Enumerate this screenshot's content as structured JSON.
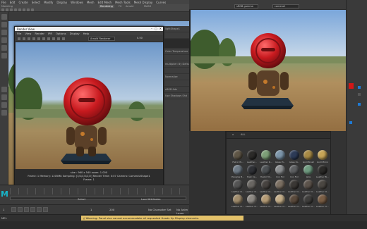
{
  "main_window": {
    "menu": [
      "File",
      "Edit",
      "Create",
      "Select",
      "Modify",
      "Display",
      "Windows",
      "Mesh",
      "Edit Mesh",
      "Mesh Tools",
      "Mesh Display",
      "Curves",
      "Surfaces",
      "Deform",
      "UV",
      "Generate",
      "Cache",
      "Arnold",
      "Help"
    ],
    "mode": "Modeling",
    "shelf_tabs": [
      "Rendering",
      "FX",
      "FX Caching",
      "Custom",
      "Arnold",
      "Bifrost",
      "MASH",
      "Motion Graphics",
      "XGen",
      "Substance"
    ]
  },
  "render_view": {
    "title": "Render View",
    "menu": [
      "File",
      "View",
      "Render",
      "IPR",
      "Options",
      "Display",
      "Help"
    ],
    "renderer": "Arnold Renderer",
    "zoom": "0.50",
    "info_line1": "size : 960 x 540  zoom: 1.000",
    "info_line2": "Frame: 1    Memory: 1205Mb    Sampling: [3/2/2/2/2/2]    Render Time: 0:07    Camera: CameraUShape1",
    "info_line3": "Frame: 1"
  },
  "right_viewport": {
    "dropdown_a": "sRGB gamma",
    "dropdown_b": "camera1"
  },
  "material_library": {
    "toolbar_label": "ALL",
    "materials": [
      {
        "name": "Fabric W...",
        "color": "#5f5646"
      },
      {
        "name": "Leather...",
        "color": "#2c2b29"
      },
      {
        "name": "Leather R...",
        "color": "#7d9f77"
      },
      {
        "name": "Glass Pl...",
        "color": "#7c95a9"
      },
      {
        "name": "Glass Ri...",
        "color": "#2d3b57"
      },
      {
        "name": "Gold Brush",
        "color": "#a88a45"
      },
      {
        "name": "Gold Mirror",
        "color": "#c7a557"
      },
      {
        "name": "Plexglas B...",
        "color": "#6e7a86"
      },
      {
        "name": "Plast Ca...",
        "color": "#2f3136"
      },
      {
        "name": "Plastic Mi...",
        "color": "#4d5154"
      },
      {
        "name": "Iron Foil",
        "color": "#8b8e90"
      },
      {
        "name": "Iron Foil",
        "color": "#5e6062"
      },
      {
        "name": "Jade",
        "color": "#6f9b80"
      },
      {
        "name": "Leather Bl...",
        "color": "#2b2a28"
      },
      {
        "name": "Leather Cl...",
        "color": "#545454"
      },
      {
        "name": "Leather Cl...",
        "color": "#6a6763"
      },
      {
        "name": "Leather Cl...",
        "color": "#474340"
      },
      {
        "name": "Leather Cl...",
        "color": "#7b6f62"
      },
      {
        "name": "Leather Cl...",
        "color": "#3b3835"
      },
      {
        "name": "Leather Cl...",
        "color": "#5c534b"
      },
      {
        "name": "Leather Cl...",
        "color": "#4b4742"
      },
      {
        "name": "Leather Cl...",
        "color": "#a08c6c"
      },
      {
        "name": "Leather Cl...",
        "color": "#8e8a84"
      },
      {
        "name": "Leather Cl...",
        "color": "#b49b75"
      },
      {
        "name": "Leather Cl...",
        "color": "#c3ad88"
      },
      {
        "name": "Leather Cl...",
        "color": "#5a4a3c"
      },
      {
        "name": "Leather Cl...",
        "color": "#3f3e3c"
      },
      {
        "name": "Leather Cl...",
        "color": "#7a5e45"
      }
    ]
  },
  "middle_panel": {
    "rows": [
      "lightShape1",
      "",
      "Color Temperature",
      "",
      "multiplier: By Default",
      "",
      "Normalize",
      "",
      "sRGB Adv",
      "Use Shadows Shd"
    ]
  },
  "timeline": {
    "start": "1",
    "end": "120",
    "range_start": "1",
    "range_end": "200",
    "char_set": "No Character Set",
    "anim_layer": "No Anim Layer",
    "label_select": "Select",
    "label_cache": "Load Attributes"
  },
  "command_line": {
    "lang": "MEL",
    "warning": "// Warning: Panel size cannot accommodate all requested Heads Up Display elements."
  },
  "colors": {
    "accent_red": "#d21717",
    "maya_blue": "#18b4c8"
  }
}
